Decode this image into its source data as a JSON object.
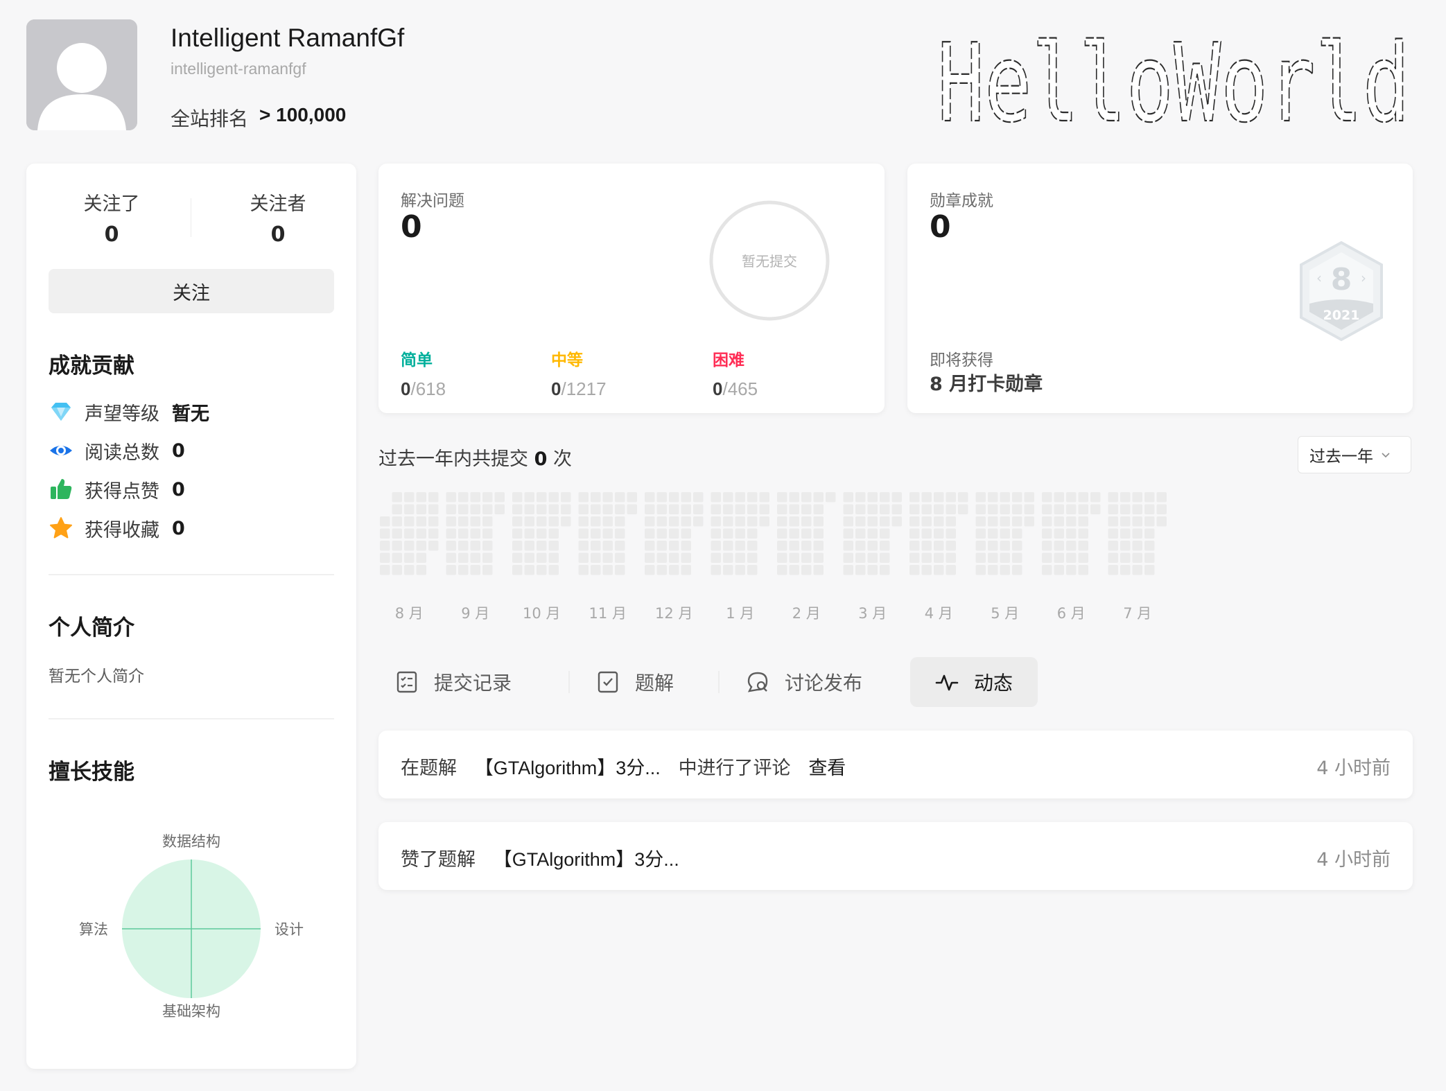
{
  "profile": {
    "display_name": "Intelligent RamanfGf",
    "username": "intelligent-ramanfgf",
    "rank_label": "全站排名",
    "rank_value": "> 100,000",
    "banner_text": "HelloWorld"
  },
  "follow": {
    "following_label": "关注了",
    "following_count": "0",
    "followers_label": "关注者",
    "followers_count": "0",
    "follow_button": "关注"
  },
  "achievements": {
    "title": "成就贡献",
    "items": [
      {
        "label": "声望等级",
        "value": "暂无",
        "icon": "diamond-icon",
        "color": "#43c0f2"
      },
      {
        "label": "阅读总数",
        "value": "0",
        "icon": "eye-icon",
        "color": "#1a73e8"
      },
      {
        "label": "获得点赞",
        "value": "0",
        "icon": "thumbs-up-icon",
        "color": "#2db55d"
      },
      {
        "label": "获得收藏",
        "value": "0",
        "icon": "star-icon",
        "color": "#ffa116"
      }
    ]
  },
  "bio": {
    "title": "个人简介",
    "text": "暂无个人简介"
  },
  "skills": {
    "title": "擅长技能",
    "axes": {
      "top": "数据结构",
      "right": "设计",
      "bottom": "基础架构",
      "left": "算法"
    },
    "fill_color": "#d8f5e6"
  },
  "problems": {
    "label": "解决问题",
    "solved": "0",
    "ring_text": "暂无提交",
    "difficulties": [
      {
        "label": "简单",
        "solved": "0",
        "total": "618",
        "color": "#00af9b"
      },
      {
        "label": "中等",
        "solved": "0",
        "total": "1217",
        "color": "#ffb800"
      },
      {
        "label": "困难",
        "solved": "0",
        "total": "465",
        "color": "#ff2d55"
      }
    ]
  },
  "badges": {
    "label": "勋章成就",
    "count": "0",
    "badge_number": "8",
    "badge_year": "2021",
    "upcoming_label": "即将获得",
    "upcoming_name": "8 月打卡勋章"
  },
  "submissions": {
    "prefix": "过去一年内共提交",
    "count": "0",
    "suffix": "次",
    "range": "过去一年",
    "months": [
      "8 月",
      "9 月",
      "10 月",
      "11 月",
      "12 月",
      "1 月",
      "2 月",
      "3 月",
      "4 月",
      "5 月",
      "6 月",
      "7 月"
    ],
    "cell_color": "#ebebeb"
  },
  "tabs": [
    {
      "label": "提交记录",
      "icon": "submission-list-icon"
    },
    {
      "label": "题解",
      "icon": "solution-check-icon"
    },
    {
      "label": "讨论发布",
      "icon": "discussion-icon"
    },
    {
      "label": "动态",
      "icon": "activity-pulse-icon",
      "active": true
    }
  ],
  "activities": [
    {
      "prefix": "在题解",
      "title": "【GTAlgorithm】3分...",
      "middle": "中进行了评论",
      "link": "查看",
      "time": "4 小时前"
    },
    {
      "prefix": "赞了题解",
      "title": "【GTAlgorithm】3分...",
      "time": "4 小时前"
    }
  ]
}
